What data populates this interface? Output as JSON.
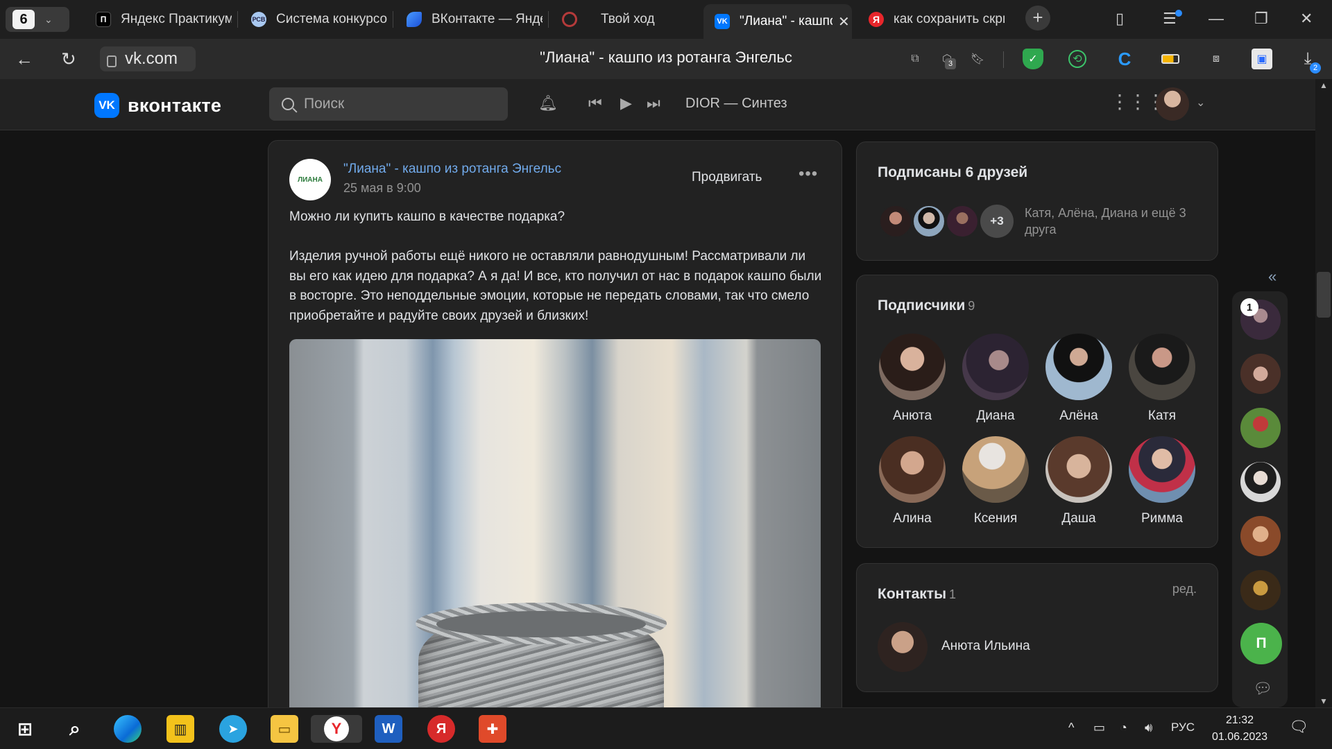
{
  "browser": {
    "tab_count": "6",
    "tabs": [
      {
        "label": "Яндекс Практикум",
        "active": false
      },
      {
        "label": "Система конкурсов",
        "active": false
      },
      {
        "label": "ВКонтакте — Яндекс",
        "active": false
      },
      {
        "label": "Твой ход",
        "active": false
      },
      {
        "label": "\"Лиана\" - кашпо из ротанга Энгельс",
        "active": true
      },
      {
        "label": "как сохранить скриншот",
        "active": false
      }
    ],
    "url": "vk.com",
    "page_title": "\"Лиана\" - кашпо из ротанга Энгельс",
    "ext_badge_count": "3",
    "download_badge": "2"
  },
  "vk_header": {
    "logo_text": "вконтакте",
    "search_placeholder": "Поиск",
    "now_playing": "DIOR — Синтез"
  },
  "post": {
    "group_name": "\"Лиана\" - кашпо из ротанга Энгельс",
    "group_logo_text": "ЛИАНА",
    "date": "25 мая в 9:00",
    "promote_label": "Продвигать",
    "more_label": "•••",
    "text": "Можно ли купить кашпо в качестве подарка?\n\nИзделия ручной работы ещё никого не оставляли равнодушным! Рассматривали ли вы его как идею для подарка? А я да! И все, кто получил от нас в подарок кашпо были в восторге. Это неподдельные эмоции, которые не передать словами, так что смело приобретайте и радуйте своих друзей и близких!"
  },
  "friends_subscribed": {
    "title": "Подписаны 6 друзей",
    "more_count": "+3",
    "note": "Катя, Алёна, Диана и ещё 3 друга"
  },
  "subscribers": {
    "title": "Подписчики",
    "count": "9",
    "items": [
      {
        "name": "Анюта",
        "color": "#6b5a52"
      },
      {
        "name": "Диана",
        "color": "#3a2f3f"
      },
      {
        "name": "Алёна",
        "color": "#8fa8c2"
      },
      {
        "name": "Катя",
        "color": "#3c3a36"
      },
      {
        "name": "Алина",
        "color": "#6a4a3a"
      },
      {
        "name": "Ксения",
        "color": "#b99a78"
      },
      {
        "name": "Даша",
        "color": "#7a5a4a"
      },
      {
        "name": "Римма",
        "color": "#6f8fb0"
      }
    ]
  },
  "contacts": {
    "title": "Контакты",
    "count": "1",
    "edit_label": "ред.",
    "contact_name": "Анюта Ильина"
  },
  "chat_strip": {
    "collapse_label": "«",
    "badge": "1",
    "letter_avatar": "П"
  },
  "taskbar": {
    "language": "РУС",
    "time": "21:32",
    "date": "01.06.2023"
  }
}
